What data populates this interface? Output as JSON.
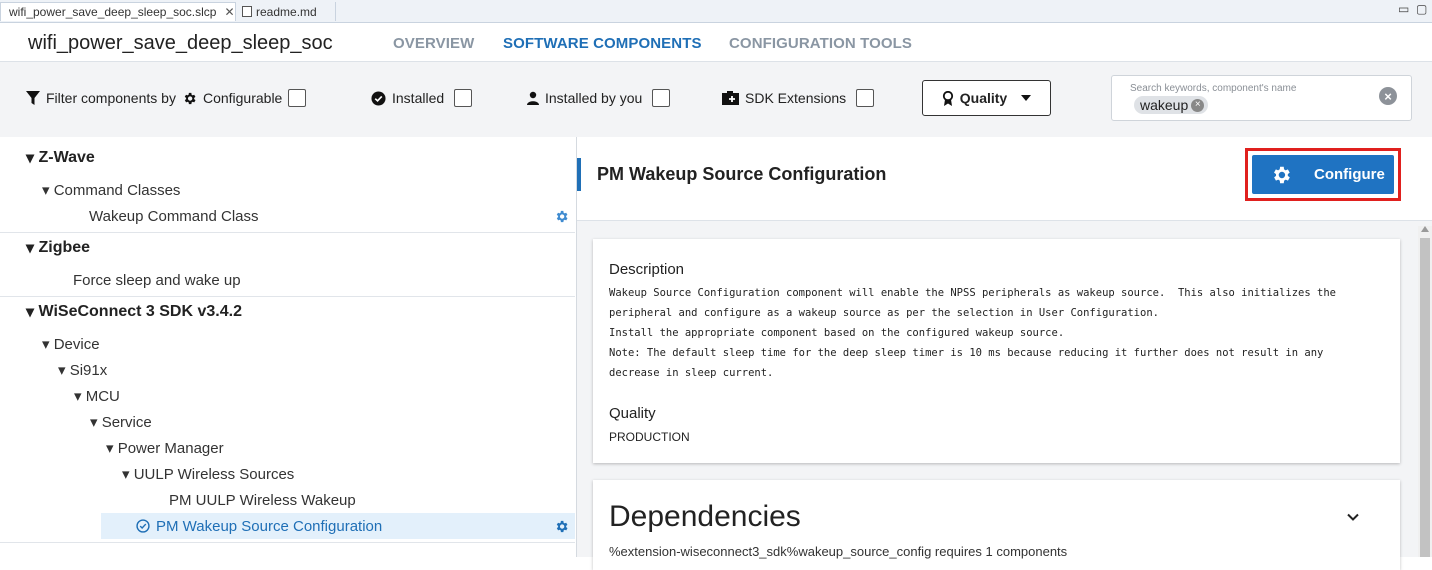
{
  "tabs": [
    {
      "label": "wifi_power_save_deep_sleep_soc.slcp",
      "close": "✕"
    },
    {
      "label": "readme.md"
    }
  ],
  "window_controls": {
    "minimize": "▭",
    "maximize": "▢"
  },
  "header": {
    "title": "wifi_power_save_deep_sleep_soc",
    "nav": [
      "OVERVIEW",
      "SOFTWARE COMPONENTS",
      "CONFIGURATION TOOLS"
    ]
  },
  "filters": {
    "filter_label": "Filter components by",
    "configurable": "Configurable",
    "installed": "Installed",
    "installed_by_you": "Installed by you",
    "sdk_extensions": "SDK Extensions",
    "quality": "Quality",
    "search_placeholder": "Search keywords, component's name",
    "search_chip": "wakeup"
  },
  "tree": {
    "zwave": "Z-Wave",
    "command_classes": "Command Classes",
    "wakeup_command_class": "Wakeup Command Class",
    "zigbee": "Zigbee",
    "force_sleep": "Force sleep and wake up",
    "wiseconnect": "WiSeConnect 3 SDK v3.4.2",
    "device": "Device",
    "si91x": "Si91x",
    "mcu": "MCU",
    "service": "Service",
    "power_manager": "Power Manager",
    "uulp_sources": "UULP Wireless Sources",
    "pm_uulp_wireless": "PM UULP Wireless Wakeup",
    "pm_wakeup_source": "PM Wakeup Source Configuration"
  },
  "details": {
    "title": "PM Wakeup Source Configuration",
    "configure_label": "Configure",
    "description_heading": "Description",
    "description_lines": [
      "Wakeup Source Configuration component will enable the NPSS peripherals as wakeup source.  This also initializes the",
      "peripheral and configure as a wakeup source as per the selection in User Configuration.",
      "Install the appropriate component based on the configured wakeup source.",
      "Note: The default sleep time for the deep sleep timer is 10 ms because reducing it further does not result in any",
      "decrease in sleep current."
    ],
    "quality_heading": "Quality",
    "quality_value": "PRODUCTION",
    "dependencies_heading": "Dependencies",
    "dependencies_text": "%extension-wiseconnect3_sdk%wakeup_source_config requires 1 components"
  },
  "colors": {
    "accent": "#1f6fb6",
    "configure_button": "#1f73c2",
    "highlight_outline": "#e0201e"
  }
}
